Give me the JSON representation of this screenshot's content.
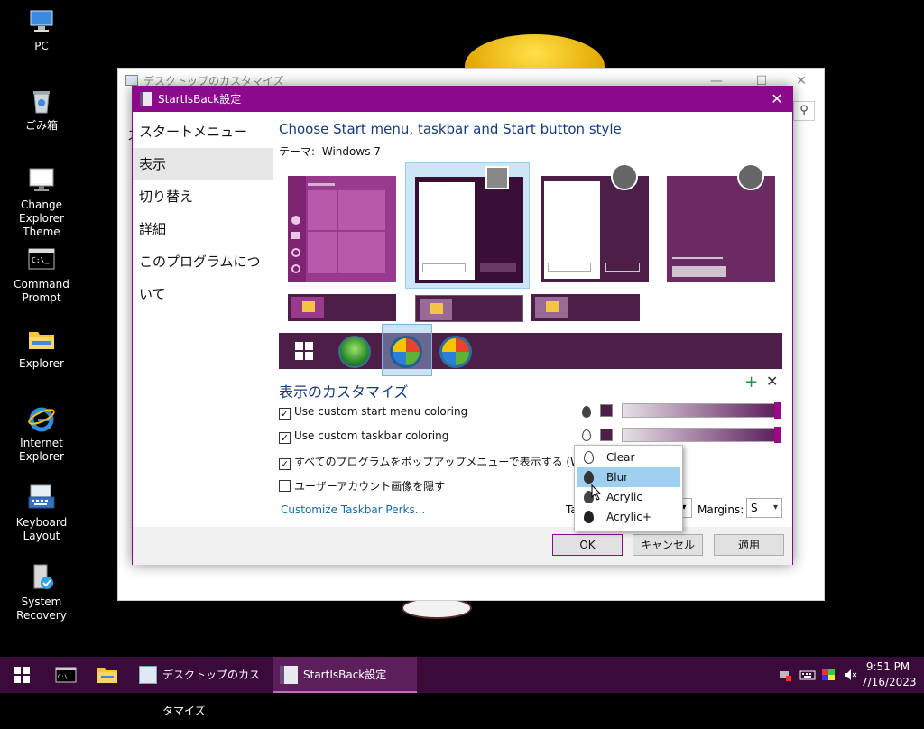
{
  "desktop": {
    "icons": [
      {
        "label": "PC",
        "icon": "pc-icon"
      },
      {
        "label": "ごみ箱",
        "icon": "recycle-bin-icon"
      },
      {
        "label": "Change Explorer Theme",
        "icon": "monitor-icon"
      },
      {
        "label": "Command Prompt",
        "icon": "command-prompt-icon"
      },
      {
        "label": "Explorer",
        "icon": "folder-icon"
      },
      {
        "label": "Internet Explorer",
        "icon": "internet-explorer-icon"
      },
      {
        "label": "Keyboard Layout",
        "icon": "keyboard-icon"
      },
      {
        "label": "System Recovery",
        "icon": "system-recovery-icon"
      }
    ]
  },
  "bg_window": {
    "title": "デスクトップのカスタマイズ",
    "fragment": "ス"
  },
  "dialog": {
    "title": "StartIsBack設定",
    "close": "✕",
    "nav": [
      "スタートメニュー",
      "表示",
      "切り替え",
      "詳細",
      "このプログラムについて"
    ],
    "selected_nav": "表示",
    "heading": "Choose Start menu, taskbar and Start button style",
    "theme_label": "テーマ:",
    "theme_value": "Windows 7",
    "customize_heading": "表示のカスタマイズ",
    "options": [
      {
        "label": "Use custom start menu coloring",
        "checked": true
      },
      {
        "label": "Use custom taskbar coloring",
        "checked": true
      },
      {
        "label": "すべてのプログラムをポップアップメニューで表示する (Windows",
        "checked": true
      },
      {
        "label": "ユーザーアカウント画像を隠す",
        "checked": false
      }
    ],
    "perks_link": "Customize Taskbar Perks...",
    "taskbar_label_fragment": "Ta",
    "margins_label": "Margins:",
    "margins_value": "S",
    "buttons": {
      "ok": "OK",
      "cancel": "キャンセル",
      "apply": "適用"
    },
    "colors": {
      "accent": "#8b0a8b",
      "swatch": "#4d1e47",
      "link": "#1a6aa0",
      "heading": "#173b7a"
    }
  },
  "menu": {
    "items": [
      "Clear",
      "Blur",
      "Acrylic",
      "Acrylic+"
    ],
    "highlighted": "Blur"
  },
  "taskbar": {
    "tasks": [
      {
        "label": "デスクトップのカスタマイズ",
        "icon": "window-icon"
      },
      {
        "label": "StartIsBack設定",
        "icon": "startisback-icon",
        "active": true
      }
    ],
    "time": "9:51 PM",
    "date": "7/16/2023"
  }
}
